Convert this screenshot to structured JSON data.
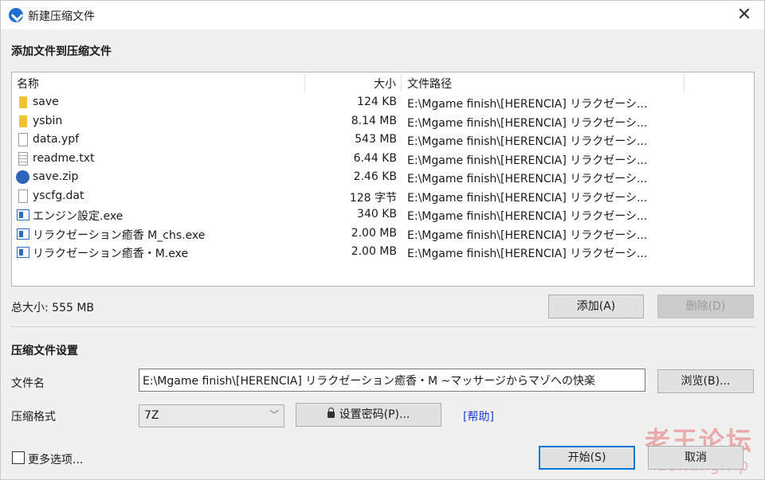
{
  "window": {
    "title": "新建压缩文件",
    "close_glyph": "✕"
  },
  "add_section": {
    "heading": "添加文件到压缩文件"
  },
  "file_list": {
    "headers": {
      "name": "名称",
      "size": "大小",
      "path": "文件路径"
    },
    "rows": [
      {
        "icon": "folder-icon",
        "name": "save",
        "size": "124 KB",
        "path": "E:\\Mgame  finish\\[HERENCIA] リラクゼーシ..."
      },
      {
        "icon": "folder-icon",
        "name": "ysbin",
        "size": "8.14 MB",
        "path": "E:\\Mgame  finish\\[HERENCIA] リラクゼーシ..."
      },
      {
        "icon": "file-icon",
        "name": "data.ypf",
        "size": "543 MB",
        "path": "E:\\Mgame  finish\\[HERENCIA] リラクゼーシ..."
      },
      {
        "icon": "text-file-icon",
        "name": "readme.txt",
        "size": "6.44 KB",
        "path": "E:\\Mgame  finish\\[HERENCIA] リラクゼーシ..."
      },
      {
        "icon": "zip-icon",
        "name": "save.zip",
        "size": "2.46 KB",
        "path": "E:\\Mgame  finish\\[HERENCIA] リラクゼーシ..."
      },
      {
        "icon": "file-icon",
        "name": "yscfg.dat",
        "size": "128 字节",
        "path": "E:\\Mgame  finish\\[HERENCIA] リラクゼーシ..."
      },
      {
        "icon": "exe-icon",
        "name": "エンジン設定.exe",
        "size": "340 KB",
        "path": "E:\\Mgame  finish\\[HERENCIA] リラクゼーシ..."
      },
      {
        "icon": "exe-icon",
        "name": "リラクゼーション癒香 M_chs.exe",
        "size": "2.00 MB",
        "path": "E:\\Mgame  finish\\[HERENCIA] リラクゼーシ..."
      },
      {
        "icon": "exe-icon",
        "name": "リラクゼーション癒香・M.exe",
        "size": "2.00 MB",
        "path": "E:\\Mgame  finish\\[HERENCIA] リラクゼーシ..."
      }
    ]
  },
  "total_size": "总大小: 555 MB",
  "buttons": {
    "add": "添加(A)",
    "remove": "删除(D)",
    "browse": "浏览(B)...",
    "set_password": "设置密码(P)...",
    "start": "开始(S)",
    "cancel": "取消"
  },
  "settings_section": {
    "heading": "压缩文件设置",
    "filename_label": "文件名",
    "filename_value": "E:\\Mgame  finish\\[HERENCIA] リラクゼーション癒香・M ~マッサージからマゾへの快楽",
    "format_label": "压缩格式",
    "format_value": "7Z",
    "help_link": "[帮助]"
  },
  "more_options": {
    "label": "更多选项...",
    "checked": false
  },
  "watermark": {
    "line1": "老王论坛",
    "line2": "laowang.vip"
  },
  "colors": {
    "accent": "#0078d7",
    "link": "#1a3fd1",
    "folder": "#f0c233"
  }
}
